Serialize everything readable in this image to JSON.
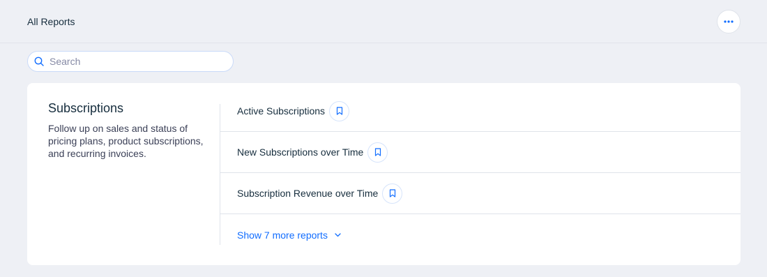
{
  "header": {
    "title": "All Reports",
    "more_icon": "more-horizontal-icon"
  },
  "search": {
    "placeholder": "Search",
    "value": "",
    "icon": "search-icon"
  },
  "section": {
    "title": "Subscriptions",
    "description": "Follow up on sales and status of pricing plans, product subscriptions, and recurring invoices.",
    "reports": [
      {
        "label": "Active Subscriptions",
        "icon": "bookmark-icon"
      },
      {
        "label": "New Subscriptions over Time",
        "icon": "bookmark-icon"
      },
      {
        "label": "Subscription Revenue over Time",
        "icon": "bookmark-icon"
      }
    ],
    "show_more_label": "Show 7 more reports"
  },
  "colors": {
    "accent": "#116dff",
    "background": "#eef0f5",
    "text": "#162d3d"
  }
}
